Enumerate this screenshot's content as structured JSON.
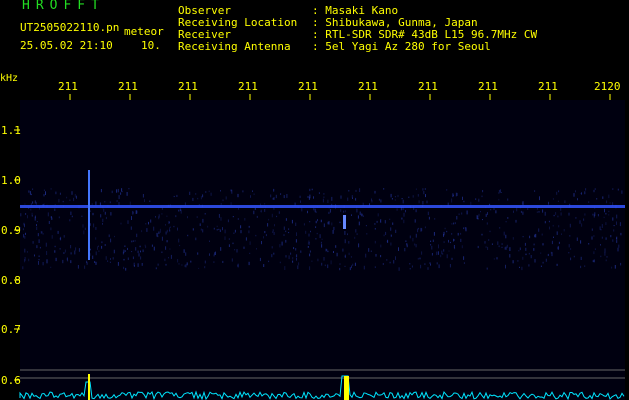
{
  "header": {
    "brand": "HROFFT",
    "filename": "UT2505022110.pn",
    "meteor_label": "meteor",
    "timestamp": "25.05.02 21:10",
    "time_value": "10.",
    "fields": [
      {
        "label": "Observer",
        "value": ": Masaki Kano"
      },
      {
        "label": "Receiving Location",
        "value": ": Shibukawa, Gunma, Japan"
      },
      {
        "label": "Receiver",
        "value": ": RTL-SDR SDR# 43dB L15 96.7MHz CW"
      },
      {
        "label": "Receiving Antenna",
        "value": ": 5el Yagi Az 280 for Seoul"
      }
    ]
  },
  "axes": {
    "y_unit": "kHz",
    "y_ticks": [
      "1.1",
      "1.0",
      "0.9",
      "0.8",
      "0.7",
      "0.6"
    ],
    "x_ticks": [
      "211",
      "211",
      "211",
      "211",
      "211",
      "211",
      "211",
      "211",
      "211",
      "2120"
    ]
  },
  "colors": {
    "text_primary": "#ffff00",
    "text_brand": "#22dd22",
    "background": "#000010",
    "trace": "#3355ff",
    "power": "#00e5ff",
    "marker": "#ffff00"
  }
}
